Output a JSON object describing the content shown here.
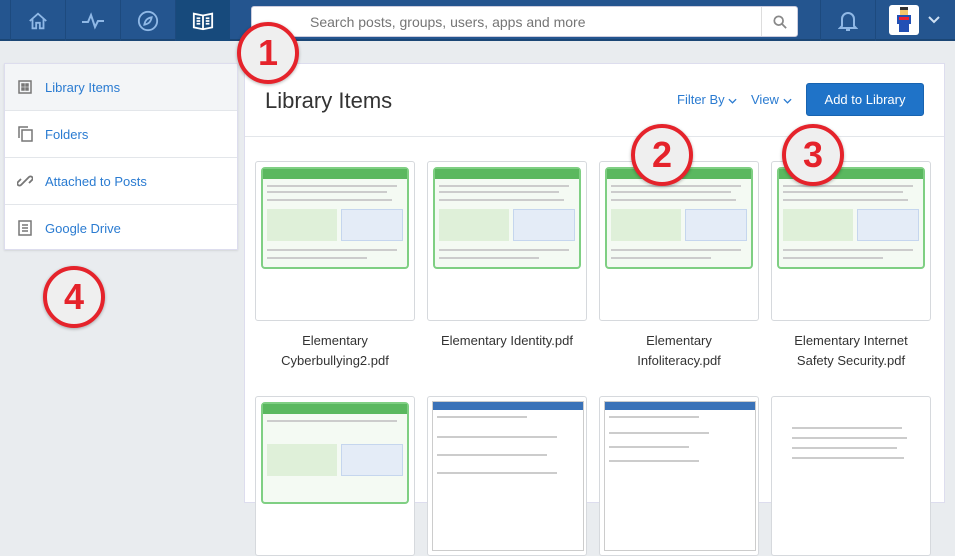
{
  "topbar": {
    "tabs": [
      {
        "icon": "home-icon"
      },
      {
        "icon": "activity-icon"
      },
      {
        "icon": "compass-icon"
      },
      {
        "icon": "library-icon",
        "active": true
      }
    ],
    "search_placeholder": "Search posts, groups, users, apps and more"
  },
  "sidebar": {
    "items": [
      {
        "label": "Library Items",
        "icon": "grid-icon"
      },
      {
        "label": "Folders",
        "icon": "folders-icon"
      },
      {
        "label": "Attached to Posts",
        "icon": "link-icon"
      },
      {
        "label": "Google Drive",
        "icon": "document-icon"
      }
    ]
  },
  "main": {
    "title": "Library Items",
    "filter_label": "Filter By",
    "view_label": "View",
    "add_label": "Add to Library",
    "items": [
      {
        "name": "Elementary Cyberbullying2.pdf"
      },
      {
        "name": "Elementary Identity.pdf"
      },
      {
        "name": "Elementary Infoliteracy.pdf"
      },
      {
        "name": "Elementary Internet Safety Security.pdf"
      }
    ]
  },
  "callouts": [
    "1",
    "2",
    "3",
    "4"
  ],
  "colors": {
    "topbar": "#24558f",
    "accent": "#2a7bd1",
    "button": "#1f73c8",
    "callout": "#e5232b"
  }
}
